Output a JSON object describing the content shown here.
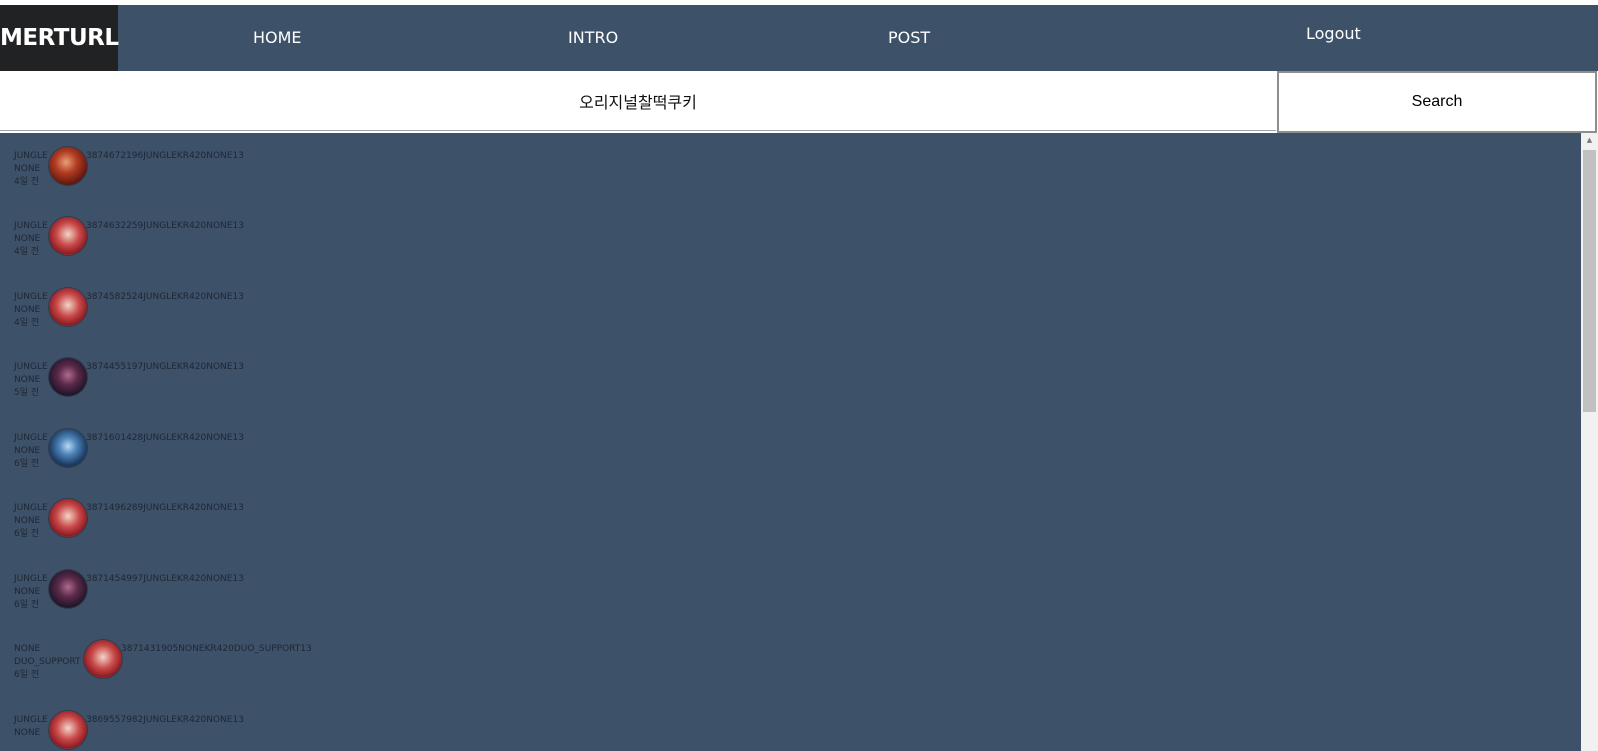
{
  "nav": {
    "brand": "MERTURL",
    "home": "HOME",
    "intro": "INTRO",
    "post": "POST",
    "logout": "Logout"
  },
  "search": {
    "value": "오리지널찰떡쿠키",
    "button_label": "Search"
  },
  "colors": {
    "navbar": "#3d5169",
    "brand_bg": "#212224",
    "content_bg": "#3d5169"
  },
  "matches": [
    {
      "role": "JUNGLE",
      "sub_role": "NONE",
      "time": "4일 전",
      "detail": "3874672196JUNGLEKR420NONE13",
      "avatar": "champion-avatar-red"
    },
    {
      "role": "JUNGLE",
      "sub_role": "NONE",
      "time": "4일 전",
      "detail": "3874632259JUNGLEKR420NONE13",
      "avatar": "champion-avatar-pink"
    },
    {
      "role": "JUNGLE",
      "sub_role": "NONE",
      "time": "4일 전",
      "detail": "3874582524JUNGLEKR420NONE13",
      "avatar": "champion-avatar-pink"
    },
    {
      "role": "JUNGLE",
      "sub_role": "NONE",
      "time": "5일 전",
      "detail": "3874455197JUNGLEKR420NONE13",
      "avatar": "champion-avatar-dark"
    },
    {
      "role": "JUNGLE",
      "sub_role": "NONE",
      "time": "6일 전",
      "detail": "3871601428JUNGLEKR420NONE13",
      "avatar": "champion-avatar-blue"
    },
    {
      "role": "JUNGLE",
      "sub_role": "NONE",
      "time": "6일 전",
      "detail": "3871496289JUNGLEKR420NONE13",
      "avatar": "champion-avatar-pink"
    },
    {
      "role": "JUNGLE",
      "sub_role": "NONE",
      "time": "6일 전",
      "detail": "3871454997JUNGLEKR420NONE13",
      "avatar": "champion-avatar-dark"
    },
    {
      "role": "NONE",
      "sub_role": "DUO_SUPPORT",
      "time": "6일 전",
      "detail": "3871431905NONEKR420DUO_SUPPORT13",
      "avatar": "champion-avatar-pink"
    },
    {
      "role": "JUNGLE",
      "sub_role": "NONE",
      "time": "",
      "detail": "3869557982JUNGLEKR420NONE13",
      "avatar": "champion-avatar-pink"
    }
  ]
}
